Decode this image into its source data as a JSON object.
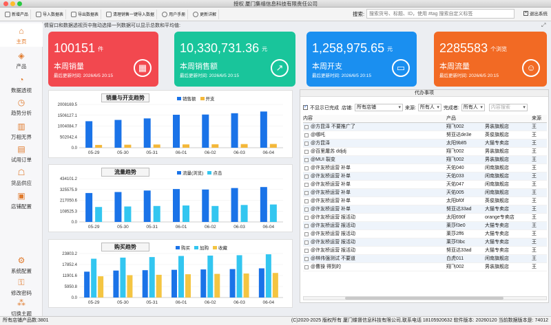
{
  "window": {
    "title": "授权 厦门集禧信息科技有限责任公司"
  },
  "toolbar": {
    "items": [
      "新增产品",
      "导入数据表",
      "导出数据表",
      "清理销售一键导入数据",
      "用户手册",
      "更新详解"
    ],
    "search_label": "搜索:",
    "search_placeholder": "搜索货号、标题、ID，使用 #tag 搜索自定义标签",
    "exit_label": "退出系统"
  },
  "sidebar": {
    "top": [
      {
        "label": "主页",
        "icon": "home-icon",
        "active": true
      },
      {
        "label": "产品",
        "icon": "box-icon"
      },
      {
        "label": "数据透视",
        "icon": "pie-chart-icon"
      },
      {
        "label": "趋势分析",
        "icon": "trend-icon"
      },
      {
        "label": "万相无界",
        "icon": "chart-bar-icon"
      },
      {
        "label": "试用订单",
        "icon": "order-icon"
      },
      {
        "label": "货品供应",
        "icon": "supply-icon"
      },
      {
        "label": "店铺配置",
        "icon": "store-icon"
      }
    ],
    "bottom": [
      {
        "label": "系统配置",
        "icon": "gear-icon"
      },
      {
        "label": "修改密码",
        "icon": "key-icon"
      },
      {
        "label": "切换主题",
        "icon": "theme-icon"
      }
    ]
  },
  "main": {
    "note": "情窗口和数据透视页中拖动选择一列数据可以显示总数和平均值:",
    "cards": [
      {
        "value": "100151",
        "unit": "件",
        "label": "本周销量",
        "updated": "最后更新时间: 2026/6/5 20:15",
        "color": "#f2484f",
        "icon": "chart-icon"
      },
      {
        "value": "10,330,731.36",
        "unit": "元",
        "label": "本周销售额",
        "updated": "最后更新时间: 2026/6/5 20:15",
        "color": "#19c59b",
        "icon": "trend-up-icon"
      },
      {
        "value": "1,258,975.65",
        "unit": "元",
        "label": "本周开支",
        "updated": "最后更新时间: 2026/6/5 20:15",
        "color": "#1a8ff0",
        "icon": "wallet-icon"
      },
      {
        "value": "2285583",
        "unit": "个浏览",
        "label": "本周流量",
        "updated": "最后更新时间: 2026/6/5 20:15",
        "color": "#f26a24",
        "icon": "user-icon"
      }
    ]
  },
  "chart_data": [
    {
      "type": "bar",
      "title": "销量与开支趋势",
      "categories": [
        "05-29",
        "05-30",
        "05-31",
        "06-01",
        "06-02",
        "06-03",
        "06-04"
      ],
      "series": [
        {
          "name": "销售额",
          "values": [
            1230000,
            1290000,
            1360000,
            1530000,
            1540000,
            1600000,
            1680000
          ],
          "color": "#1a73e8"
        },
        {
          "name": "开支",
          "values": [
            130000,
            140000,
            150000,
            155000,
            160000,
            170000,
            175000
          ],
          "color": "#f4b83a"
        }
      ],
      "yticks": [
        "2008169.5",
        "1506127.1",
        "1004084.7",
        "502042.4",
        "0.0"
      ],
      "ylim": [
        0,
        2008169.5
      ]
    },
    {
      "type": "bar",
      "title": "流量趋势",
      "categories": [
        "05-29",
        "05-30",
        "05-31",
        "06-01",
        "06-02",
        "06-03",
        "06-04"
      ],
      "series": [
        {
          "name": "流量(浏览)",
          "values": [
            290000,
            300000,
            315000,
            330000,
            325000,
            340000,
            350000
          ],
          "color": "#1a73e8"
        },
        {
          "name": "点击",
          "values": [
            150000,
            155000,
            160000,
            165000,
            160000,
            170000,
            175000
          ],
          "color": "#33c6f0"
        }
      ],
      "yticks": [
        "434101.2",
        "325575.9",
        "217050.6",
        "108525.3",
        "0.0"
      ],
      "ylim": [
        0,
        434101.2
      ]
    },
    {
      "type": "bar",
      "title": "购买趋势",
      "categories": [
        "05-29",
        "05-30",
        "05-31",
        "06-01",
        "06-02",
        "06-03",
        "06-04"
      ],
      "series": [
        {
          "name": "购买",
          "values": [
            14000,
            14600,
            14800,
            15000,
            15200,
            15400,
            15800
          ],
          "color": "#1a73e8"
        },
        {
          "name": "加购",
          "values": [
            21000,
            21600,
            21900,
            22500,
            22700,
            22900,
            23400
          ],
          "color": "#33c6f0"
        },
        {
          "name": "收藏",
          "values": [
            11500,
            12100,
            12300,
            12600,
            12800,
            13000,
            13300
          ],
          "color": "#f4c542"
        }
      ],
      "yticks": [
        "23803.2",
        "17852.4",
        "11901.6",
        "5950.8",
        "0.0"
      ],
      "ylim": [
        0,
        23803.2
      ]
    }
  ],
  "todo": {
    "title": "代办事项",
    "hide_done_label": "不显示已完成",
    "store_label": "店铺:",
    "store_value": "所有店铺",
    "source_label": "来源:",
    "source_value": "所有人",
    "completer_label": "完成者:",
    "completer_value": "所有人",
    "search_placeholder": "内容搜索",
    "columns": [
      "内容",
      "产品",
      "",
      "来源"
    ],
    "rows": [
      {
        "content": "@方昆泽 不要推广了",
        "product": "翔飞002",
        "store": "男装旗舰店",
        "src": "王"
      },
      {
        "content": "@哪吒",
        "product": "努亚达de3e",
        "store": "英俊旗舰店",
        "src": "王"
      },
      {
        "content": "@方昆泽",
        "product": "太阳9b85",
        "store": "大猫专卖店",
        "src": "王"
      },
      {
        "content": "@百里屠苏 ddjdj",
        "product": "翔飞002",
        "store": "男装旗舰店",
        "src": "王"
      },
      {
        "content": "@MUI 裂变",
        "product": "翔飞002",
        "store": "男装旗舰店",
        "src": "王"
      },
      {
        "content": "@许友桥运营 补单",
        "product": "天佑040",
        "store": "闲南旗舰店",
        "src": "王"
      },
      {
        "content": "@许友桥运营 补单",
        "product": "天佑033",
        "store": "闲南旗舰店",
        "src": "王"
      },
      {
        "content": "@许友桥运营 补单",
        "product": "天佑047",
        "store": "闲南旗舰店",
        "src": "王"
      },
      {
        "content": "@许友桥运营 补单",
        "product": "天佑005",
        "store": "闲南旗舰店",
        "src": "王"
      },
      {
        "content": "@许友桥运营 补单",
        "product": "太阳bf0f",
        "store": "英俊旗舰店",
        "src": "王"
      },
      {
        "content": "@许友桥运营 补单",
        "product": "努亚达33ad",
        "store": "大猫专卖店",
        "src": "王"
      },
      {
        "content": "@许友桥运营 报活动",
        "product": "太阳690f",
        "store": "orange专卖店",
        "src": "王"
      },
      {
        "content": "@许友桥运营 报活动",
        "product": "莱莎f3e0",
        "store": "大猫专卖店",
        "src": "王"
      },
      {
        "content": "@许友桥运营 报活动",
        "product": "莱莎2ff6",
        "store": "大猫专卖店",
        "src": "王"
      },
      {
        "content": "@许友桥运营 报活动",
        "product": "莱莎f3bc",
        "store": "大猫专卖店",
        "src": "王"
      },
      {
        "content": "@许友桥运营 报活动",
        "product": "努亚达33ad",
        "store": "大猫专卖店",
        "src": "王"
      },
      {
        "content": "@林伟强测试 不要道",
        "product": "白虎011",
        "store": "闲南旗舰店",
        "src": "王"
      },
      {
        "content": "@曹操 得到的",
        "product": "翔飞002",
        "store": "男装旗舰店",
        "src": "王"
      }
    ]
  },
  "status": {
    "left": "所有店铺产品数:3801",
    "right": "(C)2020-2025 版权所有 厦门蝶督信息科技有限公司,联系电话 18105920632  软件版本: 20260120 当前数据版本是: 74012"
  }
}
